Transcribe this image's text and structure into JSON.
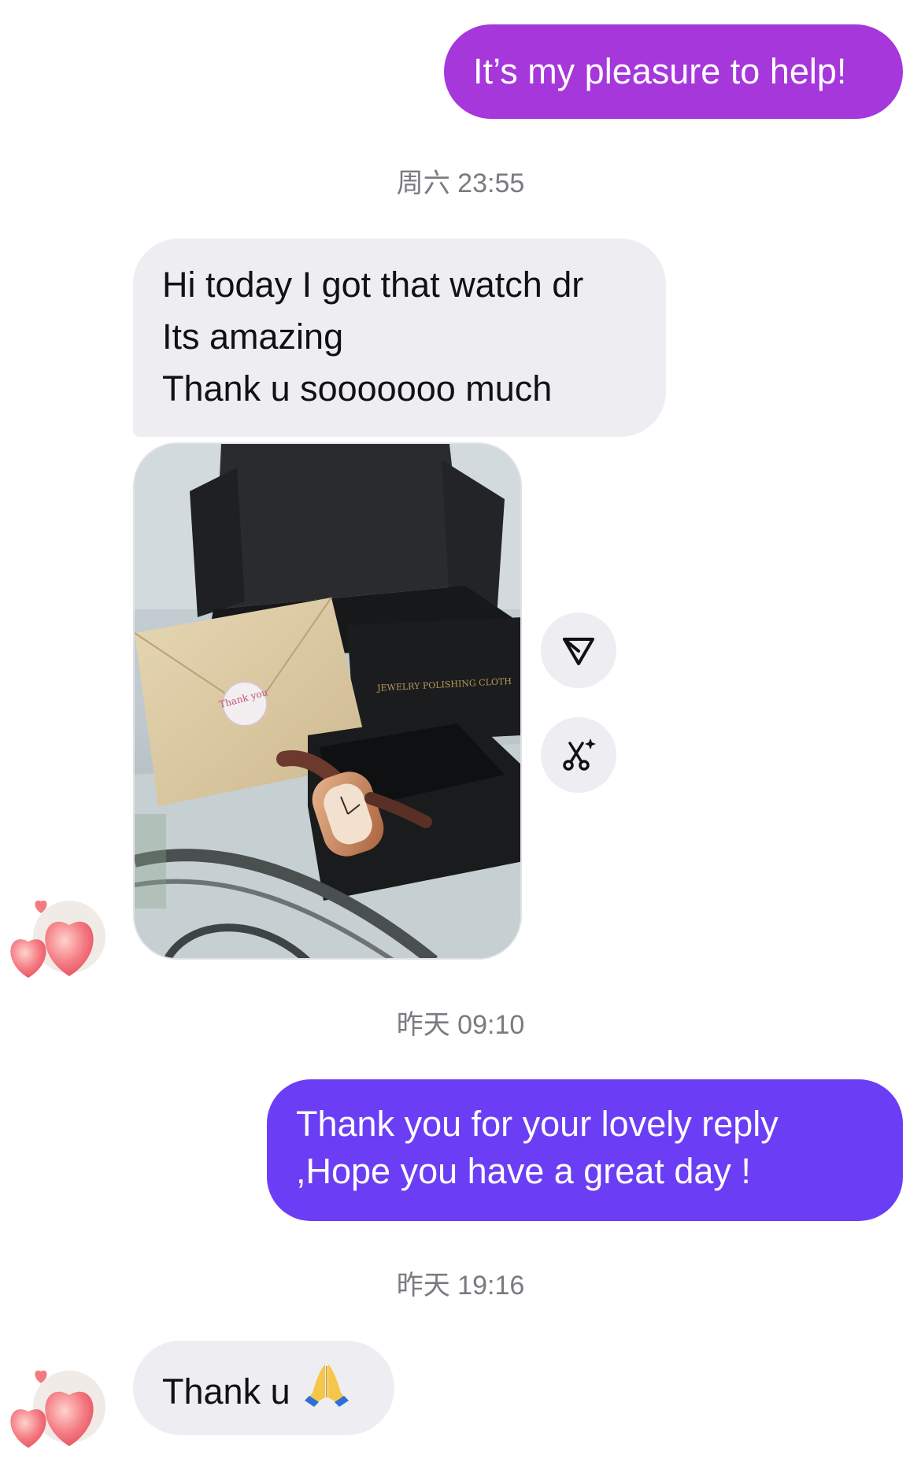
{
  "messages": {
    "outgoing_1": "It’s my pleasure to help!",
    "timestamp_1": "周六 23:55",
    "incoming_1": {
      "line_1": "Hi today I got that watch dr",
      "line_2": "Its amazing",
      "line_3": "Thank u sooooooo much"
    },
    "incoming_photo": {
      "card_text": "JEWELRY POLISHING CLOTH",
      "sticker_text": "Thank you"
    },
    "timestamp_2": "昨天 09:10",
    "outgoing_2": "Thank you for your lovely reply ,Hope you have a great day !",
    "timestamp_3": "昨天 19:16",
    "incoming_2": "Thank u"
  },
  "actions": {
    "share_icon": "paper-plane-icon",
    "edit_icon": "scissors-sparkle-icon"
  },
  "colors": {
    "outgoing_pink": "#a537db",
    "outgoing_purple": "#6b3ef5",
    "incoming_gray": "#eeeef2",
    "timestamp_gray": "#7a7a80"
  }
}
